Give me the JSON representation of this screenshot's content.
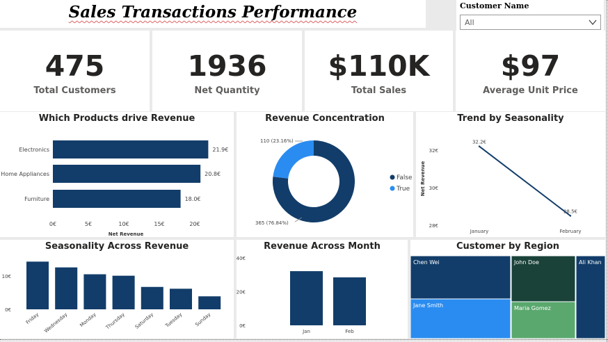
{
  "header": {
    "title": "Sales Transactions Performance"
  },
  "slicer": {
    "title": "Customer Name",
    "value": "All"
  },
  "kpis": [
    {
      "value": "475",
      "label": "Total Customers"
    },
    {
      "value": "1936",
      "label": "Net Quantity"
    },
    {
      "value": "$110K",
      "label": "Total Sales"
    },
    {
      "value": "$97",
      "label": "Average Unit Price"
    }
  ],
  "colors": {
    "navy": "#123d6a",
    "blue": "#2a8cf0",
    "darkgreen": "#1a4238",
    "green": "#5aa86e"
  },
  "chart_data": [
    {
      "type": "bar",
      "orientation": "horizontal",
      "title": "Which Products drive Revenue",
      "xlabel": "Net Revenue",
      "categories": [
        "Electronics",
        "Home Appliances",
        "Furniture"
      ],
      "values": [
        21.9,
        20.8,
        18.0
      ],
      "data_labels": [
        "21.9€",
        "20.8€",
        "18.0€"
      ],
      "x_ticks": [
        "0€",
        "5€",
        "10€",
        "15€",
        "20€"
      ],
      "xlim": [
        0,
        22
      ]
    },
    {
      "type": "pie",
      "style": "donut",
      "title": "Revenue Concentration",
      "categories": [
        "False",
        "True"
      ],
      "values": [
        365,
        110
      ],
      "data_labels": [
        "365 (76.84%)",
        "110 (23.16%)"
      ],
      "legend": [
        "False",
        "True"
      ],
      "legend_position": "right"
    },
    {
      "type": "line",
      "title": "Trend by Seasonality",
      "ylabel": "Net Revenue",
      "categories": [
        "January",
        "February"
      ],
      "values": [
        32.2,
        28.5
      ],
      "data_labels": [
        "32.2€",
        "28.5€"
      ],
      "y_ticks": [
        "32€",
        "30€",
        "28€"
      ],
      "ylim": [
        28,
        32.2
      ]
    },
    {
      "type": "bar",
      "title": "Seasonality Across Revenue",
      "categories": [
        "Friday",
        "Wednesday",
        "Monday",
        "Thursday",
        "Saturday",
        "Tuesday",
        "Sunday"
      ],
      "values": [
        13.2,
        11.6,
        9.7,
        9.3,
        6.2,
        5.7,
        3.6
      ],
      "y_ticks": [
        "10€",
        "0€"
      ],
      "ylim": [
        0,
        14
      ]
    },
    {
      "type": "bar",
      "title": "Revenue Across Month",
      "categories": [
        "Jan",
        "Feb"
      ],
      "values": [
        32.2,
        28.5
      ],
      "y_ticks": [
        "40€",
        "20€",
        "0€"
      ],
      "ylim": [
        0,
        40
      ]
    },
    {
      "type": "treemap",
      "title": "Customer by Region",
      "items": [
        {
          "name": "Chen Wei",
          "value": 28
        },
        {
          "name": "Jane Smith",
          "value": 22
        },
        {
          "name": "John Doe",
          "value": 21
        },
        {
          "name": "Maria Gomez",
          "value": 14
        },
        {
          "name": "Ali Khan",
          "value": 15
        }
      ]
    }
  ]
}
